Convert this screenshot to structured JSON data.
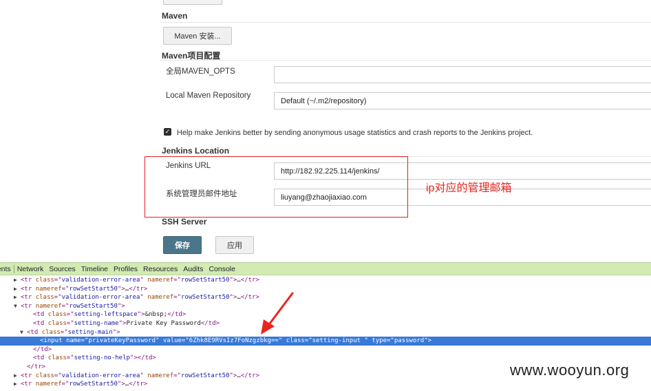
{
  "maven": {
    "title": "Maven",
    "install_button": "Maven 安装...",
    "project_config_title": "Maven项目配置",
    "global_opts_label": "全局MAVEN_OPTS",
    "global_opts_value": "",
    "local_repo_label": "Local Maven Repository",
    "local_repo_value": "Default (~/.m2/repository)"
  },
  "usage_stats": {
    "checked": true,
    "label": "Help make Jenkins better by sending anonymous usage statistics and crash reports to the Jenkins project."
  },
  "jenkins_location": {
    "title": "Jenkins Location",
    "url_label": "Jenkins URL",
    "url_value": "http://182.92.225.114/jenkins/",
    "admin_email_label": "系统管理员邮件地址",
    "admin_email_value": "liuyang@zhaojiaxiao.com"
  },
  "annotation": {
    "text": "ip对应的管理邮箱",
    "color": "#e8261e"
  },
  "ssh_server": {
    "title": "SSH Server"
  },
  "actions": {
    "save": "保存",
    "apply": "应用"
  },
  "devtools": {
    "tabs": [
      "nents",
      "Network",
      "Sources",
      "Timeline",
      "Profiles",
      "Resources",
      "Audits",
      "Console"
    ],
    "lines": [
      {
        "tri": "▶",
        "tag": "tr",
        "attrs": [
          [
            "class",
            "validation-error-area"
          ],
          [
            "nameref",
            "rowSetStart50"
          ]
        ],
        "collapsed": true
      },
      {
        "tri": "▶",
        "tag": "tr",
        "attrs": [
          [
            "nameref",
            "rowSetStart50"
          ]
        ],
        "collapsed": true
      },
      {
        "tri": "▶",
        "tag": "tr",
        "attrs": [
          [
            "class",
            "validation-error-area"
          ],
          [
            "nameref",
            "rowSetStart50"
          ]
        ],
        "collapsed": true
      },
      {
        "tri": "▼",
        "tag": "tr",
        "attrs": [
          [
            "nameref",
            "rowSetStart50"
          ]
        ],
        "open": true
      },
      {
        "tag": "td",
        "attrs": [
          [
            "class",
            "setting-leftspace"
          ]
        ],
        "text": "&nbsp;",
        "close": true
      },
      {
        "tag": "td",
        "attrs": [
          [
            "class",
            "setting-name"
          ]
        ],
        "text": "Private Key Password",
        "close": true
      },
      {
        "tri": "▼",
        "tag": "td",
        "attrs": [
          [
            "class",
            "setting-main"
          ]
        ],
        "open": true
      },
      {
        "tag": "input",
        "attrs": [
          [
            "name",
            "privateKeyPassword"
          ],
          [
            "value",
            "6Zhk8E9RVsIz7FoNzgzbkg=="
          ],
          [
            "class",
            "setting-input "
          ],
          [
            "type",
            "password"
          ]
        ],
        "selected": true
      },
      {
        "closing": "td"
      },
      {
        "tag": "td",
        "attrs": [
          [
            "class",
            "setting-no-help"
          ]
        ],
        "text": "",
        "close": true
      },
      {
        "closing": "tr"
      },
      {
        "tri": "▶",
        "tag": "tr",
        "attrs": [
          [
            "class",
            "validation-error-area"
          ],
          [
            "nameref",
            "rowSetStart50"
          ]
        ],
        "collapsed": true
      },
      {
        "tri": "▶",
        "tag": "tr",
        "attrs": [
          [
            "nameref",
            "rowSetStart50"
          ]
        ],
        "collapsed": true
      }
    ]
  },
  "watermark": "www.wooyun.org"
}
